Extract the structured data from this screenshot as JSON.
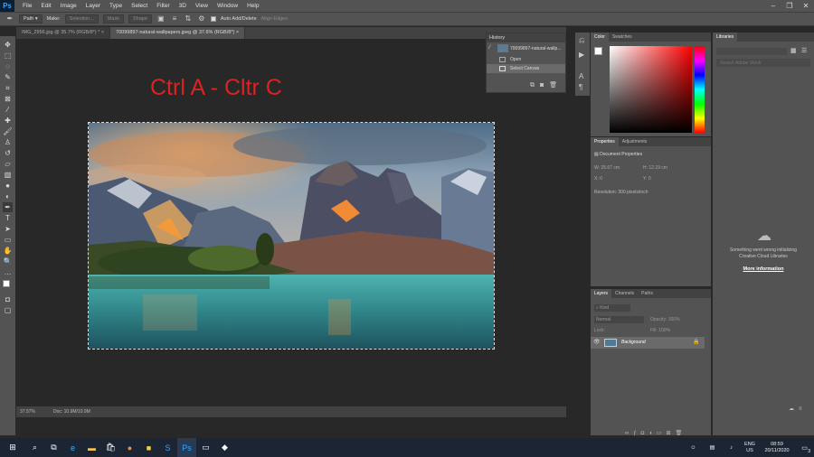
{
  "app": {
    "logo": "Ps"
  },
  "menu": [
    "File",
    "Edit",
    "Image",
    "Layer",
    "Type",
    "Select",
    "Filter",
    "3D",
    "View",
    "Window",
    "Help"
  ],
  "options": {
    "mode": "Path",
    "make_label": "Make:",
    "selection_btn": "Selection...",
    "mask_btn": "Mask",
    "shape_btn": "Shape",
    "auto_add_delete": "Auto Add/Delete",
    "align_edges": "Align Edges"
  },
  "tabs": [
    {
      "label": "IMG_2956.jpg @ 35.7% (RGB/8*) *",
      "close": "×"
    },
    {
      "label": "70099897-natural-wallpapers.jpeg @ 37.6% (RGB/8*)",
      "close": "×"
    }
  ],
  "annotation": "Ctrl A - Cltr C",
  "status": {
    "zoom": "37.57%",
    "doc": "Doc: 10.9M/10.9M"
  },
  "history": {
    "title": "History",
    "snapshot": "70099897-natural-wallp...",
    "items": [
      "Open",
      "Select Canvas"
    ]
  },
  "color_panel": {
    "tabs": [
      "Color",
      "Swatches"
    ],
    "fg": "#ffffff",
    "bg": "#000000"
  },
  "properties": {
    "tabs": [
      "Properties",
      "Adjustments"
    ],
    "section": "Document Properties",
    "w_label": "W:",
    "w_value": "25.67 cm",
    "h_label": "H:",
    "h_value": "12.19 cm",
    "x_label": "X:",
    "x_value": "0",
    "y_label": "Y:",
    "y_value": "0",
    "resolution": "Resolution: 300 pixels/inch"
  },
  "layers": {
    "tabs": [
      "Layers",
      "Channels",
      "Paths"
    ],
    "kind": "Kind",
    "blend": "Normal",
    "opacity_label": "Opacity:",
    "opacity_value": "100%",
    "lock_label": "Lock:",
    "fill_label": "Fill:",
    "fill_value": "100%",
    "layer_name": "Background"
  },
  "libraries": {
    "title": "Libraries",
    "search_placeholder": "Search Adobe Stock",
    "error_text": "Something went wrong initializing Creative Cloud Libraries",
    "more_info": "More information"
  },
  "taskbar": {
    "lang1": "ENG",
    "lang2": "US",
    "time": "08:59",
    "date": "20/11/2020",
    "notif_count": "3"
  }
}
